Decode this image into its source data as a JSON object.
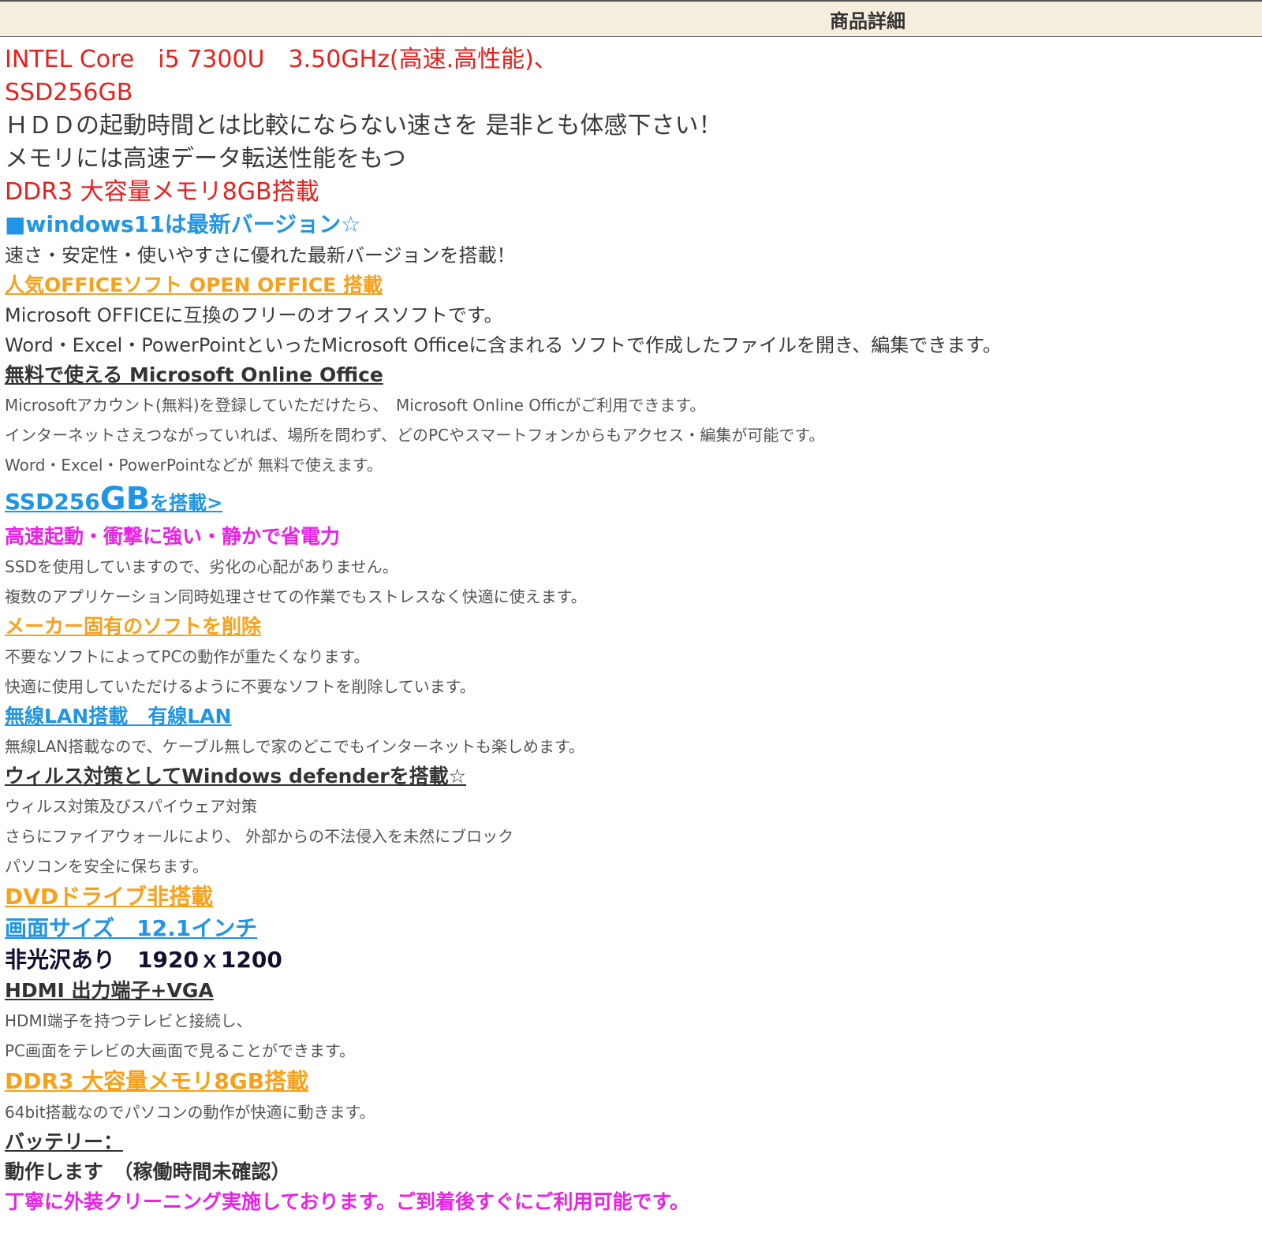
{
  "header": {
    "title": "商品詳細"
  },
  "lines": {
    "cpu": "INTEL Core　i5 7300U　3.50GHz(高速.高性能)、",
    "ssd": "SSD256GB",
    "hdd_compare": "ＨＤＤの起動時間とは比較にならない速さを 是非とも体感下さい！",
    "memory_intro": "メモリには高速データ転送性能をもつ",
    "memory": "DDR3 大容量メモリ8GB搭載",
    "windows": "■windows11は最新バージョン☆",
    "windows_desc": "速さ・安定性・使いやすさに優れた最新バージョンを搭載！",
    "office_heading": "人気OFFICEソフト OPEN OFFICE 搭載",
    "office_desc1": "Microsoft OFFICEに互換のフリーのオフィスソフトです。",
    "office_desc2": "Word・Excel・PowerPointといったMicrosoft Officeに含まれる ソフトで作成したファイルを開き、編集できます。",
    "online_heading": "無料で使える Microsoft Online Office",
    "online_desc1": "Microsoftアカウント(無料)を登録していただけたら、　Microsoft Online Officがご利用できます。",
    "online_desc2": "インターネットさえつながっていれば、場所を問わず、どのPCやスマートフォンからもアクセス・編集が可能です。",
    "online_desc3": "Word・Excel・PowerPointなどが 無料で使えます。",
    "ssd_heading_a": "SSD256",
    "ssd_heading_b": "GB",
    "ssd_heading_c": "を搭載>",
    "ssd_features": "高速起動・衝撃に強い・静かで省電力",
    "ssd_desc1": "SSDを使用していますので、劣化の心配がありません。",
    "ssd_desc2": "複数のアプリケーション同時処理させての作業でもストレスなく快適に使えます。",
    "maker_heading": "メーカー固有のソフトを削除",
    "maker_desc1": "不要なソフトによってPCの動作が重たくなります。",
    "maker_desc2": "快適に使用していただけるように不要なソフトを削除しています。",
    "lan_heading": "無線LAN搭載　有線LAN",
    "lan_desc": "無線LAN搭載なので、ケーブル無しで家のどこでもインターネットも楽しめます。",
    "virus_heading": "ウィルス対策としてWindows defenderを搭載☆",
    "virus_desc1": "ウィルス対策及びスパイウェア対策",
    "virus_desc2": "さらにファイアウォールにより、 外部からの不法侵入を未然にブロック",
    "virus_desc3": "パソコンを安全に保ちます。",
    "dvd_heading": "DVDドライブ非搭載",
    "screen_heading": "画面サイズ　12.1インチ",
    "screen_desc": "非光沢あり　1920ｘ1200",
    "hdmi_heading": "HDMI 出力端子+VGA",
    "hdmi_desc1": "HDMI端子を持つテレビと接続し、",
    "hdmi_desc2": "PC画面をテレビの大画面で見ることができます。",
    "ddr_heading": "DDR3 大容量メモリ8GB搭載",
    "ddr_desc": "64bit搭載なのでパソコンの動作が快適に動きます。",
    "battery_heading": "バッテリー：",
    "battery_desc": "動作します　（稼働時間未確認）",
    "cleaning": "丁寧に外装クリーニング実施しております。ご到着後すぐにご利用可能です。"
  }
}
